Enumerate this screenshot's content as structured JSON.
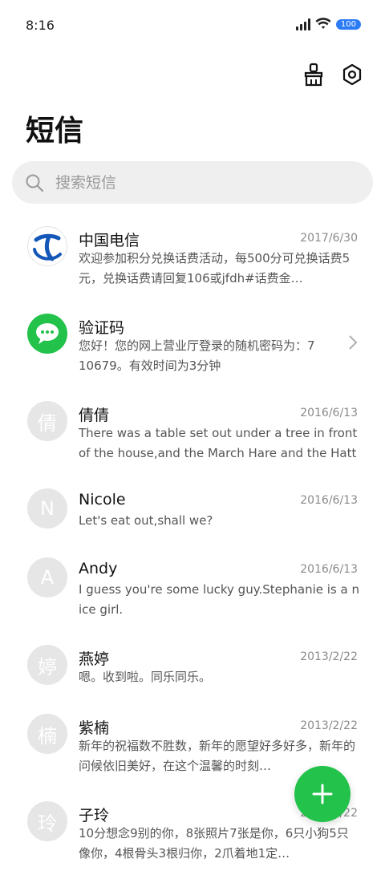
{
  "status_bar": {
    "time": "8:16",
    "battery": "100"
  },
  "toolbar": {
    "icons": [
      "brush-icon",
      "settings-icon"
    ]
  },
  "page": {
    "title": "短信"
  },
  "search": {
    "placeholder": "搜索短信"
  },
  "messages": [
    {
      "avatar": "",
      "avatar_icon": "china-telecom-logo",
      "name": "中国电信",
      "date": "2017/6/30",
      "preview": "欢迎参加积分兑换话费活动，每500分可兑换话费5元，兑换话费请回复106或jfdh#话费金…"
    },
    {
      "avatar": "",
      "avatar_icon": "message-bubble-icon",
      "name": "验证码",
      "date": "",
      "preview": "您好！您的网上营业厅登录的随机密码为：710679。有效时间为3分钟"
    },
    {
      "avatar": "倩",
      "name": "倩倩",
      "date": "2016/6/13",
      "preview": "There was a table set out under a tree in front of the house,and the March Hare and the Hatter…"
    },
    {
      "avatar": "N",
      "name": "Nicole",
      "date": "2016/6/13",
      "preview": "Let's eat out,shall we?"
    },
    {
      "avatar": "A",
      "name": "Andy",
      "date": "2016/6/13",
      "preview": "I guess you're some lucky guy.Stephanie is a nice girl."
    },
    {
      "avatar": "婷",
      "name": "燕婷",
      "date": "2013/2/22",
      "preview": "嗯。收到啦。同乐同乐。"
    },
    {
      "avatar": "楠",
      "name": "紫楠",
      "date": "2013/2/22",
      "preview": "新年的祝福数不胜数，新年的愿望好多好多，新年的问候依旧美好，在这个温馨的时刻…"
    },
    {
      "avatar": "玲",
      "name": "子玲",
      "date": "2013/2/22",
      "preview": "10分想念9别的你，8张照片7张是你，6只小狗5只像你，4根骨头3根归你，2爪着地1定…"
    }
  ],
  "colors": {
    "accent_green": "#22c24b",
    "avatar_gray": "#e6e6e6",
    "battery_blue": "#2d7cf6"
  }
}
